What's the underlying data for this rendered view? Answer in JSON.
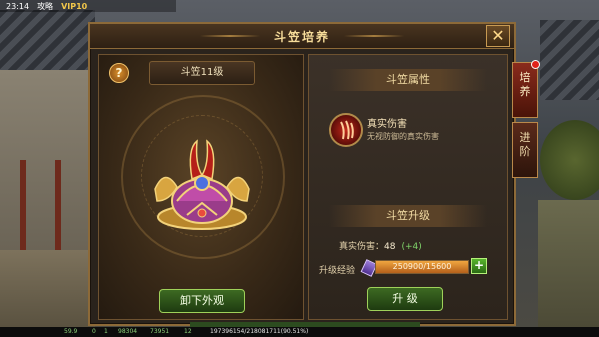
{
  "status_bar": {
    "time": "23:14",
    "carrier": "攻略",
    "vip": "VIP10"
  },
  "panel": {
    "title": "斗笠培养",
    "close_icon": "close-x-icon"
  },
  "left": {
    "help_label": "?",
    "level_tab": "斗笠11级",
    "remove_button": "卸下外观",
    "item_icon": "crown-helmet-icon"
  },
  "right": {
    "attr_section": "斗笠属性",
    "attr_name": "真实伤害",
    "attr_desc": "无视防御的真实伤害",
    "upgrade_section": "斗笠升级",
    "stat_label": "真实伤害：",
    "stat_value": "48",
    "stat_increase": "(+4)",
    "exp_label": "升级经验",
    "exp_text": "250900/15600",
    "exp_progress": 1.0,
    "exp_plus": "+",
    "upgrade_button": "升 级"
  },
  "side_tabs": [
    {
      "label": "培养",
      "active": true,
      "badge": true
    },
    {
      "label": "进阶",
      "active": false,
      "badge": false
    }
  ],
  "bottom_bar": {
    "values": [
      "59.9",
      "0",
      "1",
      "98304",
      "73951",
      "12"
    ],
    "exp": "197396154/218081711(90.51%)"
  },
  "colors": {
    "accent_gold": "#f6dc9a",
    "frame": "#8d6a38",
    "button_green": "#3d6a22",
    "exp_orange": "#f0a640"
  }
}
